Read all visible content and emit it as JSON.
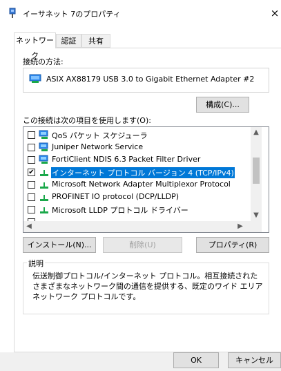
{
  "window": {
    "title": "イーサネット 7のプロパティ",
    "close_glyph": "×"
  },
  "tabs": [
    {
      "label": "ネットワーク",
      "active": true
    },
    {
      "label": "認証",
      "active": false
    },
    {
      "label": "共有",
      "active": false
    }
  ],
  "connection": {
    "label": "接続の方法:",
    "adapter_name": "ASIX AX88179 USB 3.0 to Gigabit Ethernet Adapter #2",
    "configure_button": "構成(C)..."
  },
  "items_section": {
    "label": "この接続は次の項目を使用します(O):",
    "items": [
      {
        "label": "QoS パケット スケジューラ",
        "checked": false,
        "icon": "network-service-icon",
        "selected": false
      },
      {
        "label": "Juniper Network Service",
        "checked": false,
        "icon": "network-service-icon",
        "selected": false
      },
      {
        "label": "FortiClient NDIS 6.3 Packet Filter Driver",
        "checked": false,
        "icon": "network-service-icon",
        "selected": false
      },
      {
        "label": "インターネット プロトコル バージョン 4 (TCP/IPv4)",
        "checked": true,
        "icon": "protocol-icon",
        "selected": true
      },
      {
        "label": "Microsoft Network Adapter Multiplexor Protocol",
        "checked": false,
        "icon": "protocol-icon",
        "selected": false
      },
      {
        "label": "PROFINET IO protocol (DCP/LLDP)",
        "checked": false,
        "icon": "protocol-icon",
        "selected": false
      },
      {
        "label": "Microsoft LLDP プロトコル ドライバー",
        "checked": false,
        "icon": "protocol-icon",
        "selected": false
      }
    ],
    "install_button": "インストール(N)...",
    "remove_button": "削除(U)",
    "properties_button": "プロパティ(R)"
  },
  "description": {
    "legend": "説明",
    "text": "伝送制御プロトコル/インターネット プロトコル。相互接続されたさまざまなネットワーク間の通信を提供する、既定のワイド エリア ネットワーク プロトコルです。"
  },
  "footer": {
    "ok_button": "OK",
    "cancel_button": "キャンセル"
  },
  "colors": {
    "selection": "#0078d7",
    "button_face": "#e1e1e1",
    "window_bg": "#f0f0f0"
  }
}
